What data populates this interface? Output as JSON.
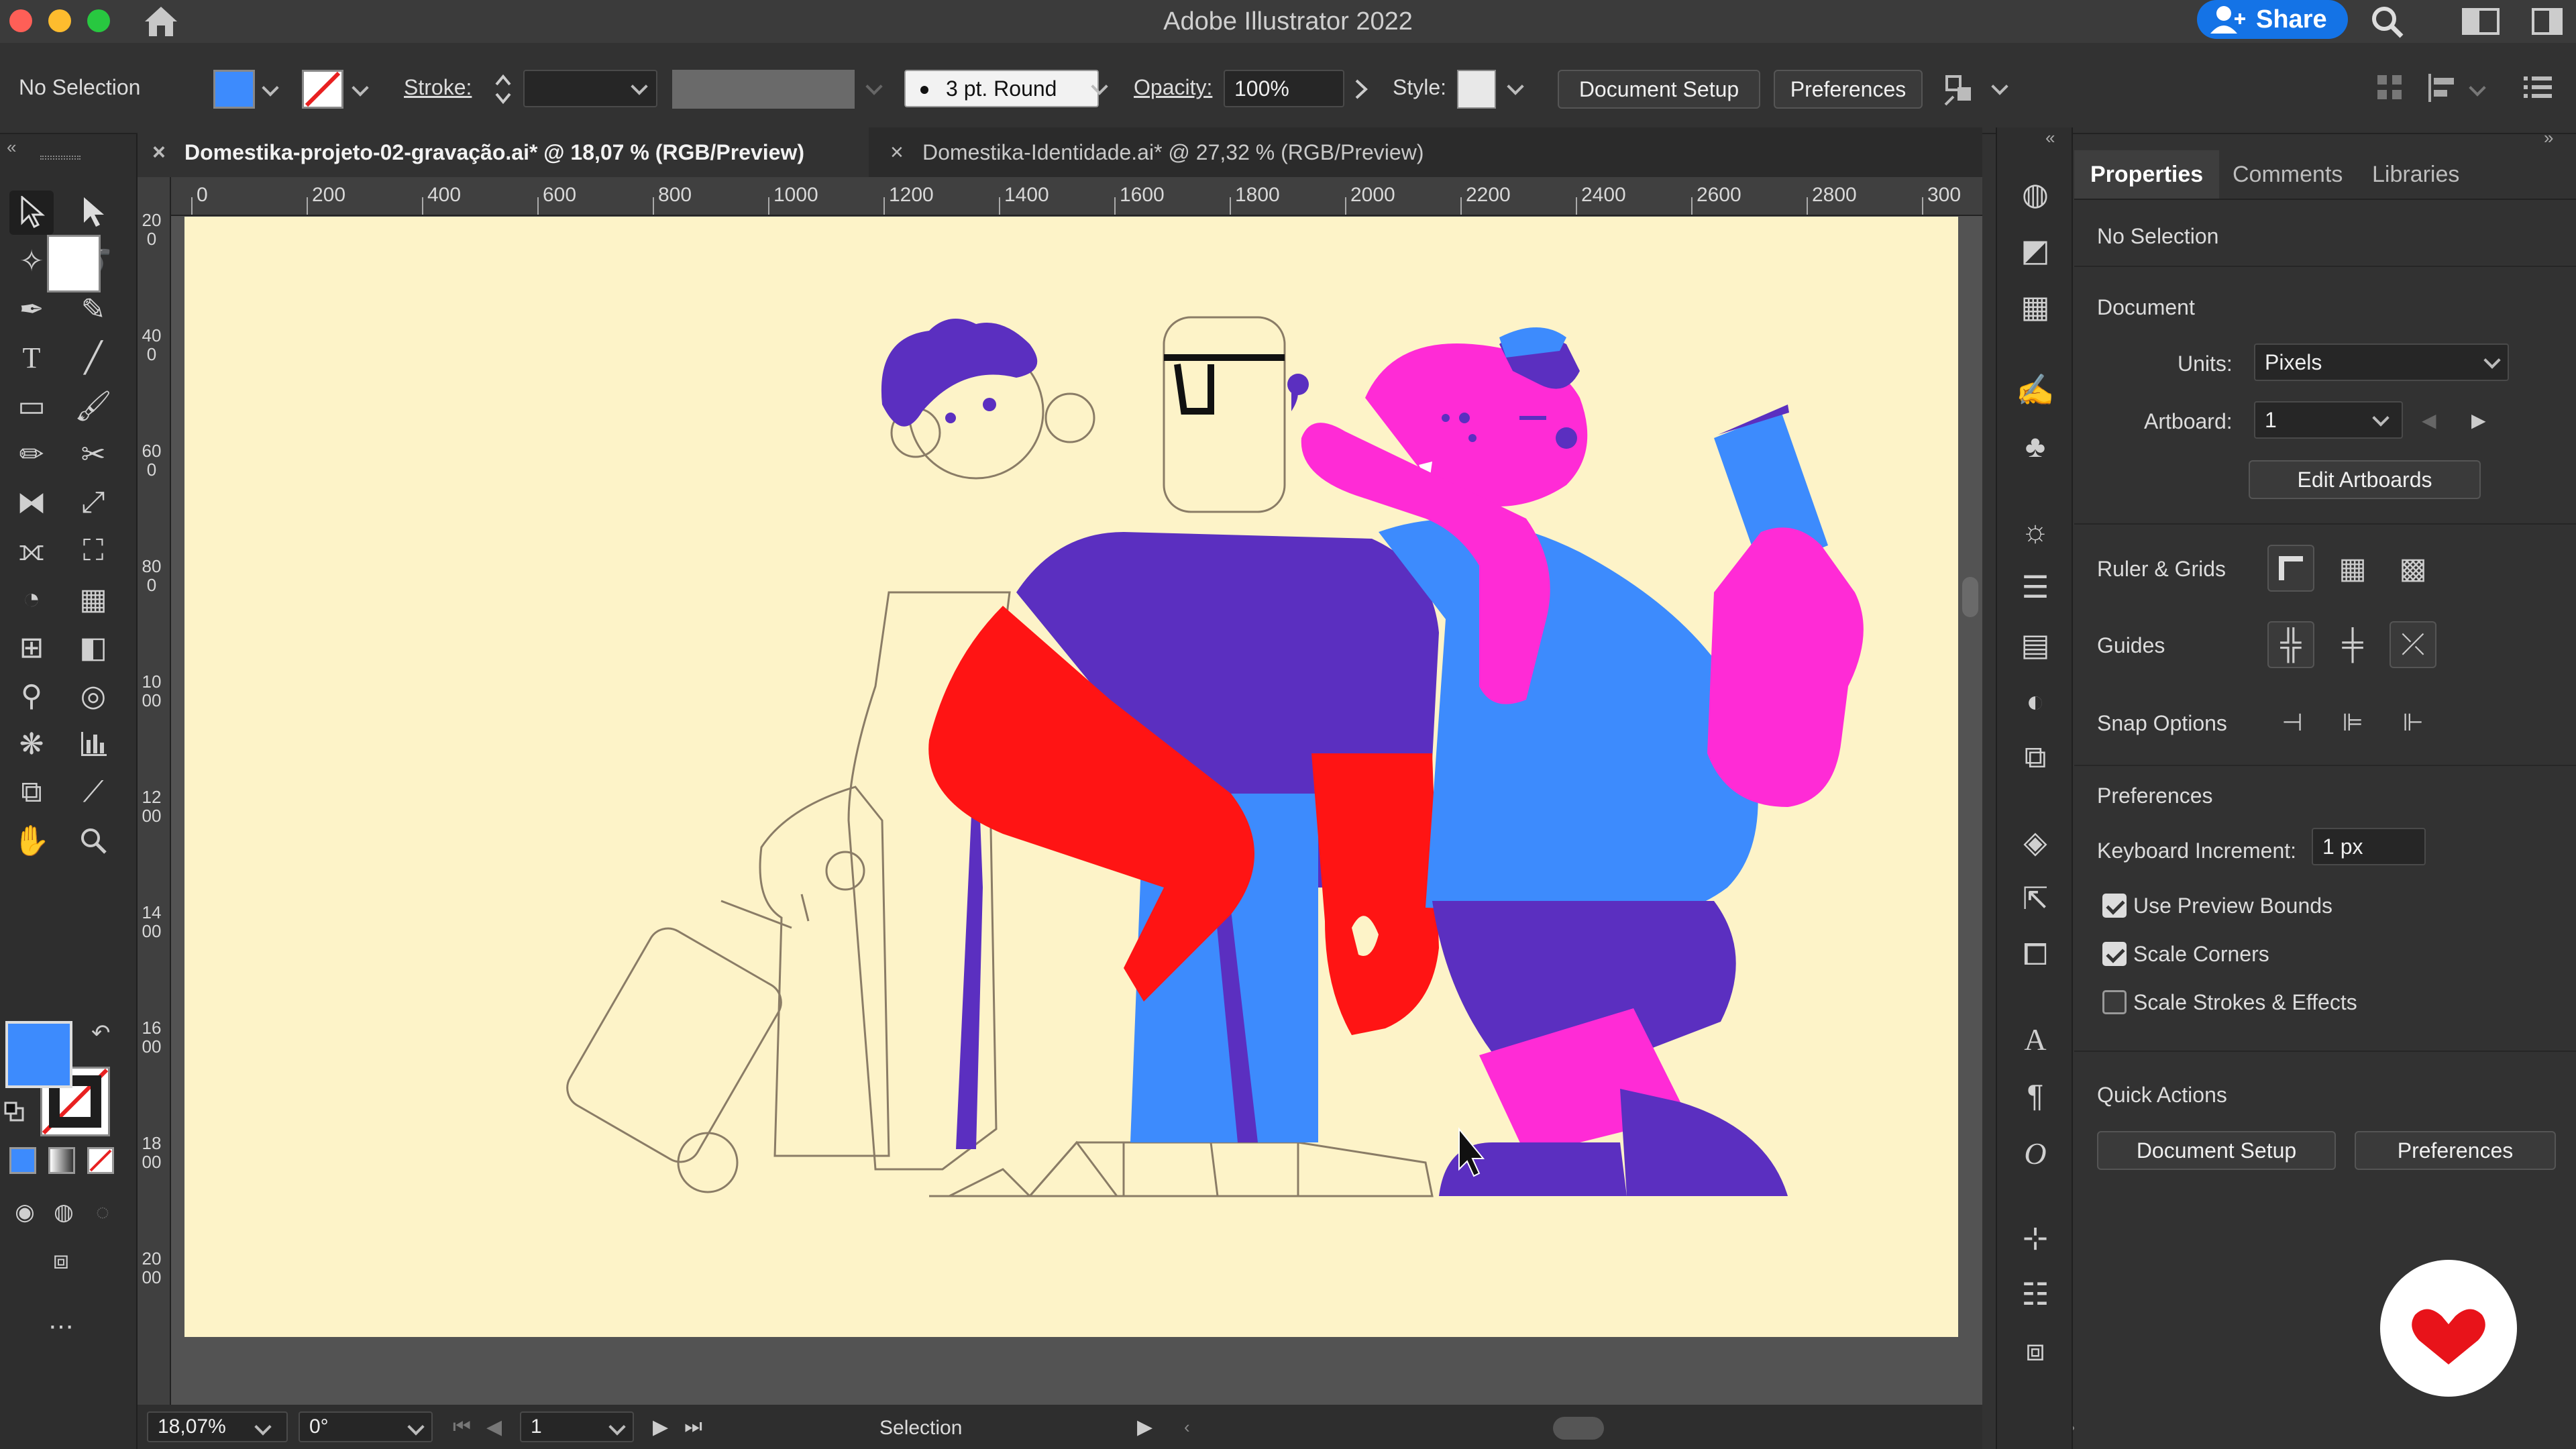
{
  "app": {
    "title": "Adobe Illustrator 2022",
    "share_label": "Share"
  },
  "colors": {
    "accent": "#1473e6",
    "artboard": "#fdf3c8",
    "blue": "#3d8bfd",
    "purple": "#5b2fc0",
    "red": "#ff1414",
    "magenta": "#ff2bd6"
  },
  "control": {
    "selection_status": "No Selection",
    "stroke_label": "Stroke:",
    "brush_value": "3 pt. Round",
    "opacity_label": "Opacity:",
    "opacity_value": "100%",
    "style_label": "Style:",
    "document_setup": "Document Setup",
    "preferences": "Preferences"
  },
  "tabs": [
    {
      "label": "Domestika-projeto-02-gravação.ai* @ 18,07 % (RGB/Preview)",
      "close": "×",
      "active": true
    },
    {
      "label": "Domestika-Identidade.ai* @ 27,32 % (RGB/Preview)",
      "close": "×",
      "active": false
    }
  ],
  "ruler": {
    "top_ticks": [
      "0",
      "200",
      "400",
      "600",
      "800",
      "1000",
      "1200",
      "1400",
      "1600",
      "1800",
      "2000",
      "2200",
      "2400",
      "2600",
      "2800",
      "300"
    ],
    "left_ticks": [
      "200",
      "400",
      "600",
      "800",
      "1000",
      "1200",
      "1400",
      "1600",
      "1800",
      "2000"
    ]
  },
  "status": {
    "zoom": "18,07%",
    "rotation": "0°",
    "artboard_number": "1",
    "tool_name": "Selection"
  },
  "panel": {
    "tabs": [
      "Properties",
      "Comments",
      "Libraries"
    ],
    "no_selection": "No Selection",
    "document_heading": "Document",
    "units_label": "Units:",
    "units_value": "Pixels",
    "artboard_label": "Artboard:",
    "artboard_value": "1",
    "edit_artboards": "Edit Artboards",
    "ruler_grids": "Ruler & Grids",
    "guides": "Guides",
    "snap_options": "Snap Options",
    "preferences_heading": "Preferences",
    "keyboard_increment_label": "Keyboard Increment:",
    "keyboard_increment_value": "1 px",
    "use_preview_bounds": "Use Preview Bounds",
    "scale_corners": "Scale Corners",
    "scale_strokes": "Scale Strokes & Effects",
    "quick_actions": "Quick Actions",
    "qa_document_setup": "Document Setup",
    "qa_preferences": "Preferences"
  }
}
